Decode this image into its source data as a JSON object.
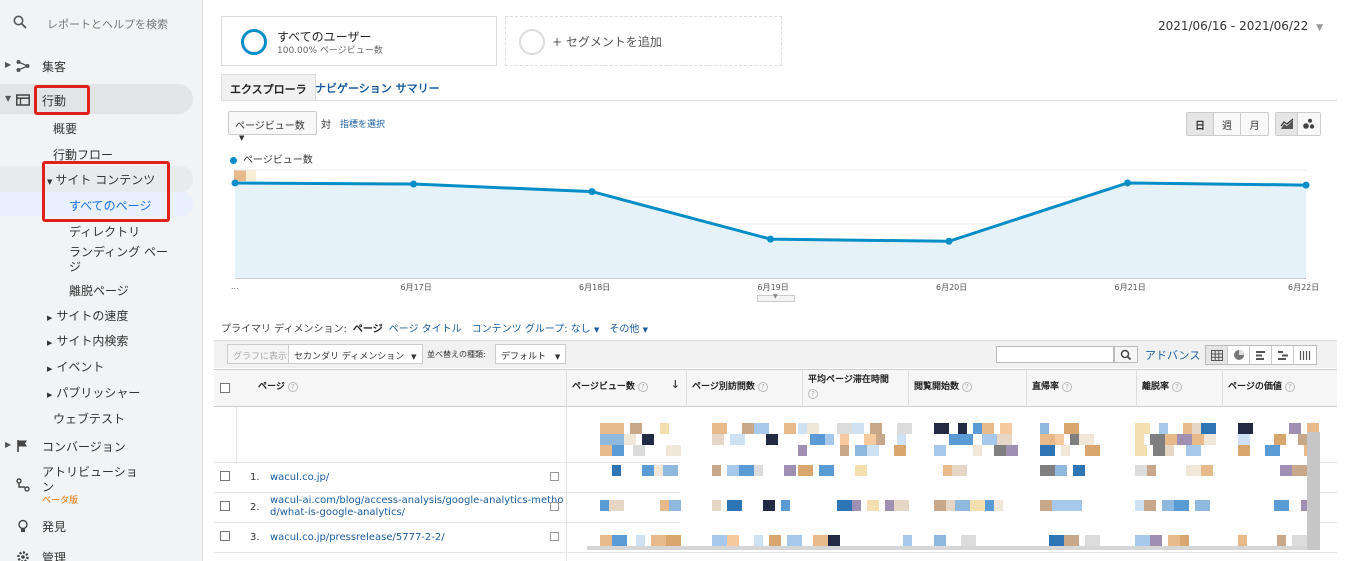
{
  "sidebar": {
    "search_placeholder": "レポートとヘルプを検索",
    "acquisition": "集客",
    "behavior": "行動",
    "overview": "概要",
    "behavior_flow": "行動フロー",
    "site_content": "サイト コンテンツ",
    "all_pages": "すべてのページ",
    "directory": "ディレクトリ",
    "landing_pages": "ランディング ページ",
    "exit_pages": "離脱ページ",
    "site_speed": "サイトの速度",
    "site_search": "サイト内検索",
    "events": "イベント",
    "publisher": "パブリッシャー",
    "experiments": "ウェブテスト",
    "conversions": "コンバージョン",
    "attribution_1": "アトリビューショ",
    "attribution_2": "ン",
    "beta": "ベータ版",
    "discover": "発見",
    "admin": "管理"
  },
  "segments": {
    "all_users_title": "すべてのユーザー",
    "all_users_sub": "100.00% ページビュー数",
    "add_segment": "+ セグメントを追加"
  },
  "date_range": "2021/06/16 - 2021/06/22",
  "tabs": {
    "explorer": "エクスプローラ",
    "nav_summary": "ナビゲーション サマリー"
  },
  "chart_controls": {
    "metric": "ページビュー数",
    "vs": "対",
    "select_metric": "指標を選択",
    "day": "日",
    "week": "週",
    "month": "月"
  },
  "chart_data": {
    "type": "area",
    "series": [
      {
        "name": "ページビュー数",
        "values": [
          88,
          87,
          80,
          36,
          34,
          88,
          86
        ]
      }
    ],
    "categories": [
      "...",
      "6月17日",
      "6月18日",
      "6月19日",
      "6月20日",
      "6月21日",
      "6月22日"
    ],
    "ylim": [
      0,
      100
    ],
    "color": "#058dc7",
    "fill": "#e6f2fa",
    "grid": true,
    "legend": "top-left"
  },
  "dimension_bar": {
    "label": "プライマリ ディメンション:",
    "current": "ページ",
    "page_title": "ページ タイトル",
    "content_group": "コンテンツ グループ: なし",
    "other": "その他"
  },
  "toolbar": {
    "chart_btn": "グラフに表示",
    "secondary_dim": "セカンダリ ディメンション",
    "sort_type_label": "並べ替えの種類:",
    "sort_default": "デフォルト",
    "advanced": "アドバンス"
  },
  "table": {
    "headers": [
      "ページ",
      "ページビュー数",
      "ページ別訪問数",
      "平均ページ滞在時間",
      "閲覧開始数",
      "直帰率",
      "離脱率",
      "ページの価値"
    ],
    "rows": [
      {
        "num": "1.",
        "url": "wacul.co.jp/"
      },
      {
        "num": "2.",
        "url_1": "wacul-ai.com/blog/access-analysis/google-analytics-metho",
        "url_2": "d/what-is-google-analytics/"
      },
      {
        "num": "3.",
        "url": "wacul.co.jp/pressrelease/5777-2-2/"
      }
    ]
  }
}
